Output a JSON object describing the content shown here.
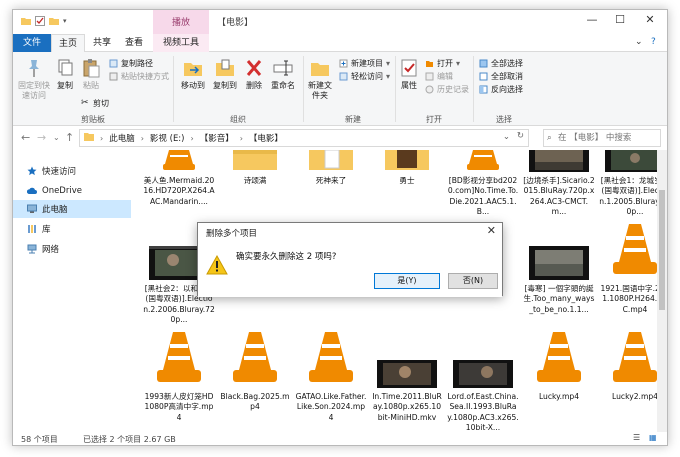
{
  "window": {
    "title": "【电影】",
    "context_tab_header": "播放",
    "controls": {
      "minimize": "—",
      "maximize": "☐",
      "close": "✕"
    }
  },
  "ribbon_tabs": [
    {
      "label": "文件",
      "active": false
    },
    {
      "label": "主页",
      "active": true
    },
    {
      "label": "共享",
      "active": false
    },
    {
      "label": "查看",
      "active": false
    },
    {
      "label": "视频工具",
      "active": false
    }
  ],
  "ribbon": {
    "clipboard": {
      "group_label": "剪贴板",
      "pin_label": "固定到快速访问",
      "copy_label": "复制",
      "paste_label": "粘贴",
      "copy_path_label": "复制路径",
      "paste_shortcut_label": "粘贴快捷方式",
      "cut_label": "剪切"
    },
    "organize": {
      "group_label": "组织",
      "move_to_label": "移动到",
      "copy_to_label": "复制到",
      "delete_label": "删除",
      "rename_label": "重命名"
    },
    "new": {
      "group_label": "新建",
      "new_folder_label": "新建文件夹",
      "new_item_label": "新建项目",
      "easy_access_label": "轻松访问"
    },
    "open": {
      "group_label": "打开",
      "properties_label": "属性",
      "open_label": "打开",
      "edit_label": "编辑",
      "history_label": "历史记录"
    },
    "select": {
      "group_label": "选择",
      "select_all_label": "全部选择",
      "select_none_label": "全部取消",
      "invert_label": "反向选择"
    }
  },
  "address": {
    "crumbs": [
      "此电脑",
      "影视 (E:)",
      "【影音】",
      "【电影】"
    ],
    "search_placeholder": "在 【电影】 中搜索"
  },
  "nav": {
    "items": [
      {
        "label": "快速访问",
        "icon": "star-icon",
        "selected": false
      },
      {
        "label": "OneDrive",
        "icon": "cloud-icon",
        "selected": false
      },
      {
        "label": "此电脑",
        "icon": "computer-icon",
        "selected": true
      },
      {
        "label": "库",
        "icon": "library-icon",
        "selected": false
      },
      {
        "label": "网络",
        "icon": "network-icon",
        "selected": false
      }
    ]
  },
  "files": {
    "row1": [
      {
        "name": "美人鱼.Mermaid.2016.HD720P.X264.AAC.Mandarin....",
        "thumb": "vlc-icon"
      },
      {
        "name": "诗颂满",
        "thumb": "folder-icon"
      },
      {
        "name": "死神来了",
        "thumb": "folder-icon"
      },
      {
        "name": "勇士",
        "thumb": "folder-icon"
      },
      {
        "name": "[BD影视分享bd2020.com]No.Time.To.Die.2021.AAC5.1.B...",
        "thumb": "vlc-icon"
      },
      {
        "name": "[边境杀手].Sicario.2015.BluRay.720p.x264.AC3-CMCT.m...",
        "thumb": "video-thumb"
      },
      {
        "name": "[黑社会1：龙城岁月(国粤双语)].Election.1.2005.Bluray.720p...",
        "thumb": "video-thumb"
      }
    ],
    "row2": [
      {
        "name": "[黑社会2：以和为贵(国粤双语)].Election.2.2006.Bluray.720p...",
        "thumb": "video-thumb"
      },
      {
        "name": "[毒寒] 一個字頭的誕生.Too_many_ways_to_be_no.1.1...",
        "thumb": "video-thumb"
      },
      {
        "name": "1921.国语中字.2021.1080P.H264.AAC.mp4",
        "thumb": "vlc-icon"
      }
    ],
    "row3": [
      {
        "name": "1993新人皮灯笼HD1080P高清中字.mp4",
        "thumb": "vlc-icon"
      },
      {
        "name": "Black.Bag.2025.mp4",
        "thumb": "vlc-icon"
      },
      {
        "name": "GATAO.Like.Father.Like.Son.2024.mp4",
        "thumb": "vlc-icon"
      },
      {
        "name": "In.Time.2011.BluRay.1080p.x265.10bit-MiniHD.mkv",
        "thumb": "video-thumb"
      },
      {
        "name": "Lord.of.East.China.Sea.II.1993.BluRay.1080p.AC3.x265.10bit-X...",
        "thumb": "video-thumb"
      },
      {
        "name": "Lucky.mp4",
        "thumb": "vlc-icon"
      },
      {
        "name": "Lucky2.mp4",
        "thumb": "vlc-icon"
      }
    ]
  },
  "status": {
    "count": "58 个项目",
    "selected": "已选择 2 个项目  2.67 GB"
  },
  "dialog": {
    "title": "删除多个项目",
    "message": "确实要永久删除这 2 项吗?",
    "yes_label": "是(Y)",
    "no_label": "否(N)",
    "close": "✕"
  },
  "colors": {
    "accent": "#1a6fc0",
    "context_tab": "#f7d9ea",
    "nav_selected": "#cce8ff",
    "vlc_orange": "#f08a00",
    "folder_yellow": "#f6c85f"
  }
}
